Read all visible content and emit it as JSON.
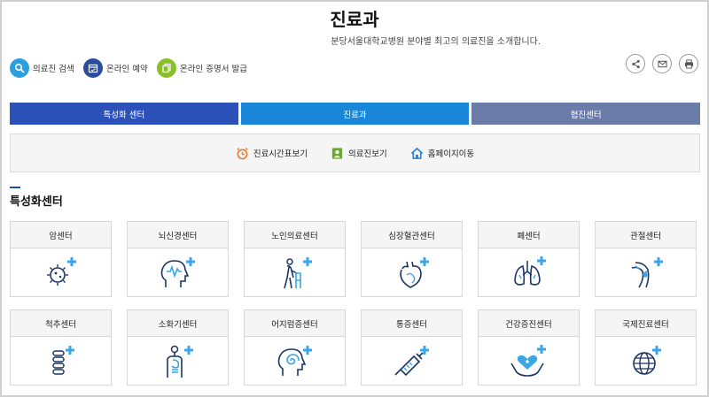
{
  "header": {
    "title": "진료과",
    "subtitle": "분당서울대학교병원 분야별 최고의 의료진을 소개합니다."
  },
  "quick_links": [
    {
      "label": "의료진 검색",
      "icon": "search-icon",
      "color": "#2b9fe0"
    },
    {
      "label": "온라인 예약",
      "icon": "calendar-icon",
      "color": "#2c4d9c"
    },
    {
      "label": "온라인 증명서 발급",
      "icon": "document-copy-icon",
      "color": "#8bbf2a"
    }
  ],
  "share_buttons": [
    "share-icon",
    "mail-icon",
    "print-icon"
  ],
  "tabs": [
    {
      "label": "특성화 센터",
      "color": "#2c51b8"
    },
    {
      "label": "진료과",
      "color": "#1a86d8"
    },
    {
      "label": "협진센터",
      "color": "#6b7ca8"
    }
  ],
  "toolbar": [
    {
      "label": "진료시간표보기",
      "icon": "alarm-clock-icon"
    },
    {
      "label": "의료진보기",
      "icon": "doctor-id-icon"
    },
    {
      "label": "홈페이지이동",
      "icon": "home-icon"
    }
  ],
  "section": {
    "title": "특성화센터"
  },
  "centers": [
    {
      "label": "암센터",
      "icon": "cancer-cell-icon"
    },
    {
      "label": "뇌신경센터",
      "icon": "brain-head-icon"
    },
    {
      "label": "노인의료센터",
      "icon": "elderly-walker-icon"
    },
    {
      "label": "심장혈관센터",
      "icon": "heart-icon"
    },
    {
      "label": "폐센터",
      "icon": "lungs-icon"
    },
    {
      "label": "관절센터",
      "icon": "knee-joint-icon"
    },
    {
      "label": "척추센터",
      "icon": "spine-icon"
    },
    {
      "label": "소화기센터",
      "icon": "digestive-organ-icon"
    },
    {
      "label": "어지럼증센터",
      "icon": "dizziness-head-icon"
    },
    {
      "label": "통증센터",
      "icon": "syringe-icon"
    },
    {
      "label": "건강증진센터",
      "icon": "health-hands-icon"
    },
    {
      "label": "국제진료센터",
      "icon": "globe-icon"
    }
  ],
  "colors": {
    "accent_blue": "#1f4ea6",
    "plus_blue": "#3aa5e8",
    "icon_navy": "#1c3563"
  }
}
